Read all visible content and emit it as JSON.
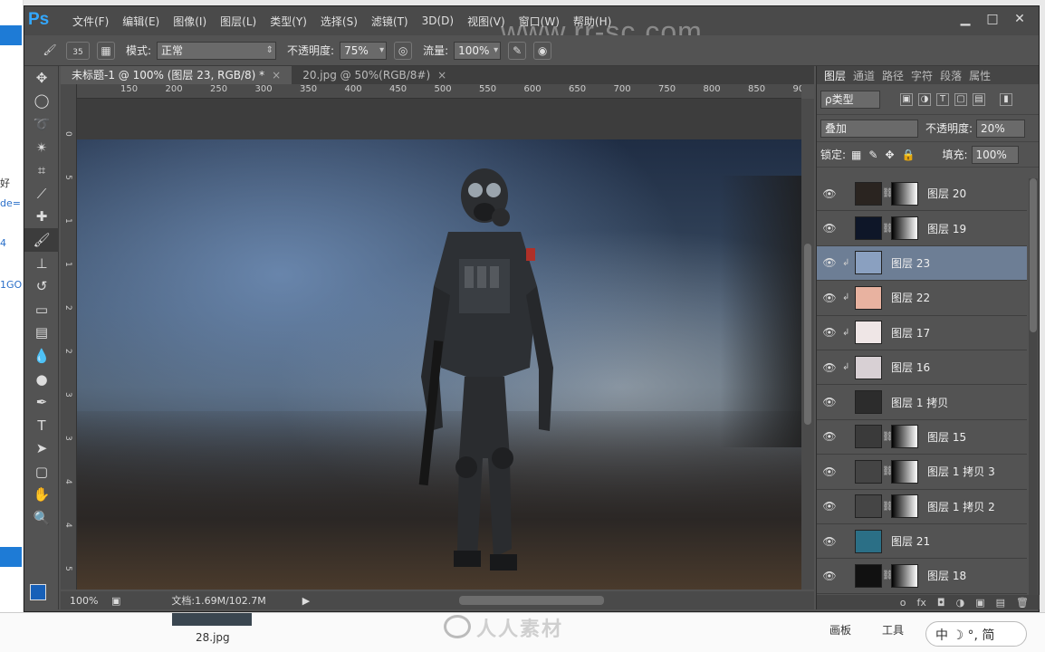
{
  "watermark": "www.rr-sc.com",
  "menu": [
    "文件(F)",
    "编辑(E)",
    "图像(I)",
    "图层(L)",
    "类型(Y)",
    "选择(S)",
    "滤镜(T)",
    "3D(D)",
    "视图(V)",
    "窗口(W)",
    "帮助(H)"
  ],
  "options": {
    "brush_size": "35",
    "mode_label": "模式:",
    "mode_value": "正常",
    "opacity_label": "不透明度:",
    "opacity_value": "75%",
    "flow_label": "流量:",
    "flow_value": "100%"
  },
  "tabs": [
    {
      "label": "未标题-1 @ 100% (图层 23, RGB/8) *",
      "close": "×"
    },
    {
      "label": "20.jpg @ 50%(RGB/8#)",
      "close": "×"
    }
  ],
  "ruler_ticks": [
    "150",
    "200",
    "250",
    "300",
    "350",
    "400",
    "450",
    "500",
    "550",
    "600",
    "650",
    "700",
    "750",
    "800",
    "850",
    "900"
  ],
  "ruler_left_ticks": [
    "0",
    "5",
    "1",
    "1",
    "2",
    "2",
    "3",
    "3",
    "4",
    "4",
    "5"
  ],
  "status": {
    "zoom": "100%",
    "doc": "文档:1.69M/102.7M"
  },
  "panel_tabs": [
    "图层",
    "通道",
    "路径",
    "字符",
    "段落",
    "属性"
  ],
  "layers_panel": {
    "filter_label": "ρ类型",
    "blend_mode": "叠加",
    "opacity_label": "不透明度:",
    "opacity_value": "20%",
    "lock_label": "锁定:",
    "fill_label": "填充:",
    "fill_value": "100%"
  },
  "layers": [
    {
      "name": "图层 20",
      "thumb": "#2a2420",
      "mask": true,
      "clip": false,
      "selected": false
    },
    {
      "name": "图层 19",
      "thumb": "#0e1628",
      "mask": true,
      "clip": false,
      "selected": false
    },
    {
      "name": "图层 23",
      "thumb": "#8aa0c0",
      "mask": false,
      "clip": true,
      "selected": true
    },
    {
      "name": "图层 22",
      "thumb": "#e8b2a0",
      "mask": false,
      "clip": true,
      "selected": false
    },
    {
      "name": "图层 17",
      "thumb": "#efe6e6",
      "mask": false,
      "clip": true,
      "selected": false
    },
    {
      "name": "图层 16",
      "thumb": "#d8d0d4",
      "mask": false,
      "clip": true,
      "selected": false
    },
    {
      "name": "图层 1 拷贝",
      "thumb": "#2c2c2c",
      "mask": false,
      "clip": false,
      "selected": false
    },
    {
      "name": "图层 15",
      "thumb": "#3a3a3a",
      "mask": true,
      "clip": false,
      "selected": false
    },
    {
      "name": "图层 1 拷贝 3",
      "thumb": "#444444",
      "mask": true,
      "clip": false,
      "selected": false
    },
    {
      "name": "图层 1 拷贝 2",
      "thumb": "#454545",
      "mask": true,
      "clip": false,
      "selected": false
    },
    {
      "name": "图层 21",
      "thumb": "#2b6f86",
      "mask": false,
      "clip": false,
      "selected": false
    },
    {
      "name": "图层 18",
      "thumb": "#111111",
      "mask": true,
      "clip": false,
      "selected": false
    }
  ],
  "panel_footer": [
    "ᴏ",
    "fx",
    "◘",
    "◑",
    "▣",
    "▤",
    "🗑"
  ],
  "desktop": {
    "left_fragments": [
      "好",
      "de=",
      "4",
      "1GO"
    ],
    "bottom_thumb_label": "28.jpg",
    "bottom_watermark": "人人素材",
    "bottom_tabs": [
      "画板",
      "工具"
    ],
    "ime": "中 ☽ °, 简"
  },
  "colors": {
    "foreground": "#1760b8",
    "background": "#ffffff",
    "accent": "#33a8ff",
    "selected_layer": "#6d7e95"
  }
}
